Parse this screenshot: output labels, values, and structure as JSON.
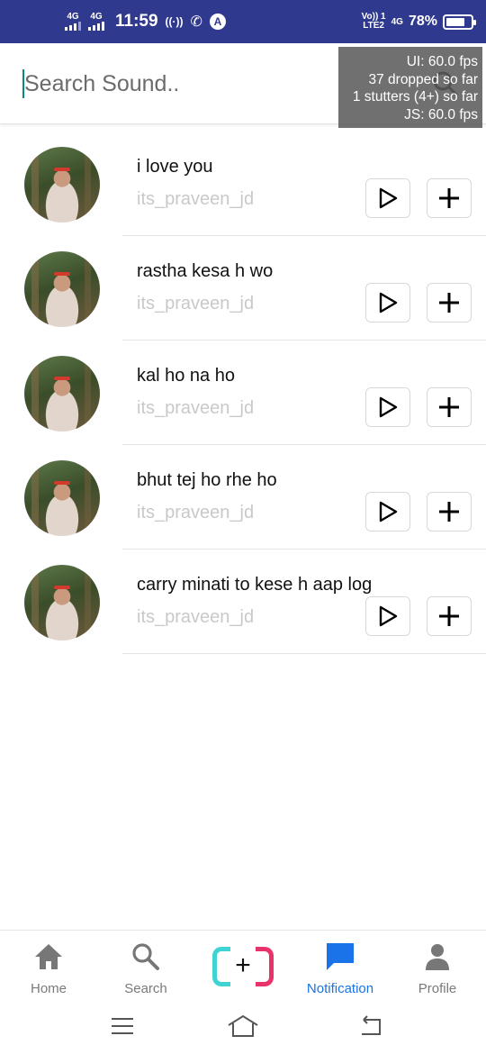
{
  "status_bar": {
    "net1": "4G",
    "net2": "4G",
    "time": "11:59",
    "hotspot_glyph": "((·))",
    "call_glyph": "✆",
    "app_glyph": "A",
    "volte_top": "Vo)) 1",
    "volte_bottom": "LTE2",
    "net3": "4G",
    "battery": "78%",
    "battery_level": 0.78
  },
  "search": {
    "placeholder": "Search Sound..",
    "icon": "search-icon"
  },
  "perf_overlay": {
    "ui": "UI: 60.0 fps",
    "dropped": "37 dropped so far",
    "stutters": "1 stutters (4+) so far",
    "js": "JS: 60.0 fps"
  },
  "sounds": [
    {
      "title": "i love you",
      "author": "its_praveen_jd"
    },
    {
      "title": "rastha kesa h wo",
      "author": "its_praveen_jd"
    },
    {
      "title": "kal ho na ho",
      "author": "its_praveen_jd"
    },
    {
      "title": "bhut tej ho rhe ho",
      "author": "its_praveen_jd"
    },
    {
      "title": "carry minati to kese h aap log",
      "author": "its_praveen_jd"
    }
  ],
  "bottom_nav": {
    "home": "Home",
    "search": "Search",
    "create": "+",
    "notification": "Notification",
    "profile": "Profile",
    "active_color": "#1a73e8"
  }
}
